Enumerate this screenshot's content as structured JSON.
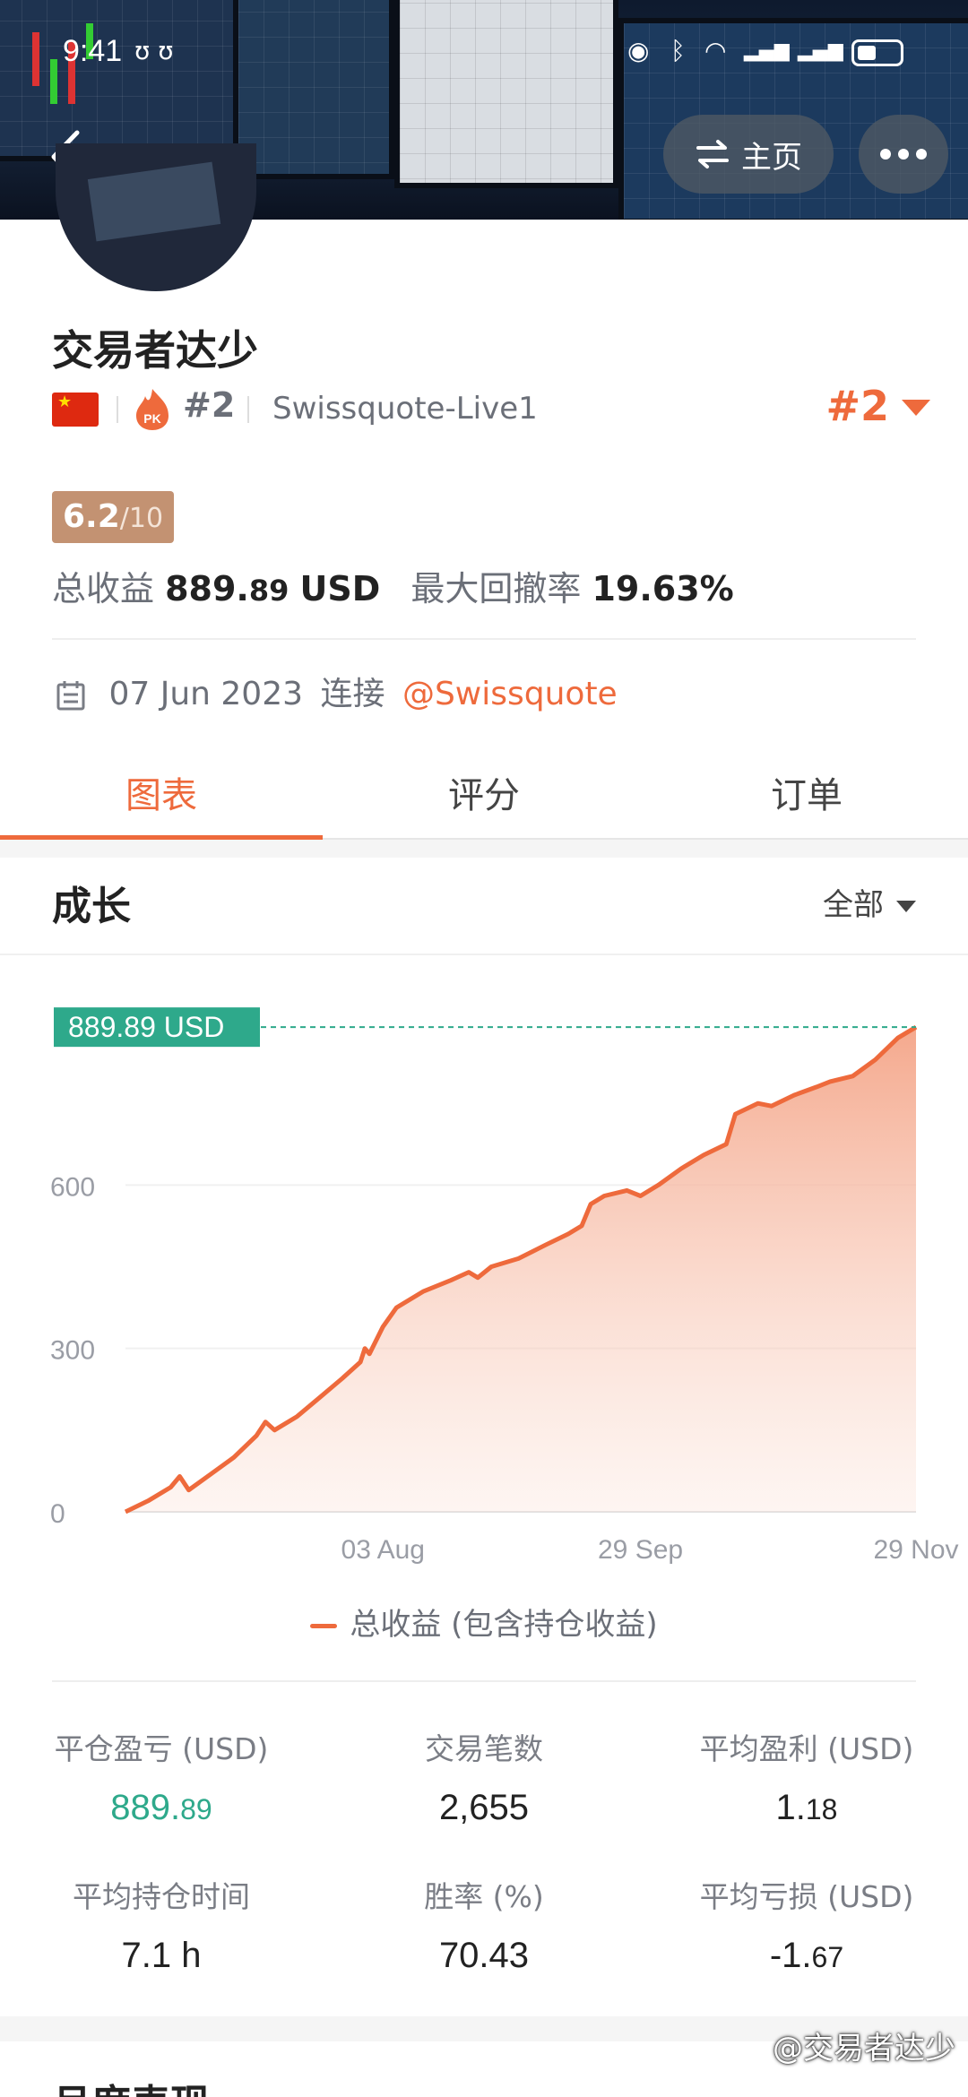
{
  "status_bar": {
    "time": "9:41"
  },
  "header": {
    "home_label": "主页"
  },
  "profile": {
    "name": "交易者达少",
    "rank_small": "#2",
    "server": "Swissquote-Live1",
    "rank_big": "#2",
    "score": "6.2",
    "score_denominator": "/10",
    "total_profit_label": "总收益",
    "total_profit_int": "889.",
    "total_profit_dec": "89",
    "total_profit_unit": "USD",
    "max_drawdown_label": "最大回撤率",
    "max_drawdown_value": "19.63%",
    "connect_date": "07 Jun 2023",
    "connect_label": "连接",
    "broker_link": "@Swissquote"
  },
  "tabs": [
    {
      "label": "图表",
      "active": true
    },
    {
      "label": "评分",
      "active": false
    },
    {
      "label": "订单",
      "active": false
    }
  ],
  "section": {
    "title": "成长",
    "filter": "全部"
  },
  "chart_data": {
    "type": "area",
    "title": "",
    "xlabel": "",
    "ylabel": "",
    "y_ticks": [
      0,
      300,
      600
    ],
    "x_ticks": [
      {
        "label": "03 Aug",
        "date": "2023-08-03"
      },
      {
        "label": "29 Sep",
        "date": "2023-09-29"
      },
      {
        "label": "29 Nov",
        "date": "2023-11-29"
      }
    ],
    "ylim": [
      0,
      900
    ],
    "xlim": [
      "2023-06-07",
      "2023-11-29"
    ],
    "current_label": "889.89 USD",
    "current_value": 889.89,
    "series": [
      {
        "name": "总收益 (包含持仓收益)",
        "points": [
          [
            "2023-06-07",
            0
          ],
          [
            "2023-06-12",
            20
          ],
          [
            "2023-06-17",
            45
          ],
          [
            "2023-06-19",
            65
          ],
          [
            "2023-06-21",
            40
          ],
          [
            "2023-06-26",
            70
          ],
          [
            "2023-07-01",
            100
          ],
          [
            "2023-07-06",
            140
          ],
          [
            "2023-07-08",
            165
          ],
          [
            "2023-07-10",
            150
          ],
          [
            "2023-07-15",
            175
          ],
          [
            "2023-07-20",
            210
          ],
          [
            "2023-07-25",
            245
          ],
          [
            "2023-07-29",
            275
          ],
          [
            "2023-07-30",
            300
          ],
          [
            "2023-07-31",
            290
          ],
          [
            "2023-08-03",
            340
          ],
          [
            "2023-08-06",
            375
          ],
          [
            "2023-08-12",
            405
          ],
          [
            "2023-08-18",
            425
          ],
          [
            "2023-08-22",
            440
          ],
          [
            "2023-08-24",
            430
          ],
          [
            "2023-08-27",
            450
          ],
          [
            "2023-09-02",
            465
          ],
          [
            "2023-09-08",
            490
          ],
          [
            "2023-09-13",
            510
          ],
          [
            "2023-09-16",
            525
          ],
          [
            "2023-09-18",
            565
          ],
          [
            "2023-09-21",
            580
          ],
          [
            "2023-09-26",
            590
          ],
          [
            "2023-09-29",
            580
          ],
          [
            "2023-10-03",
            600
          ],
          [
            "2023-10-08",
            630
          ],
          [
            "2023-10-13",
            655
          ],
          [
            "2023-10-18",
            675
          ],
          [
            "2023-10-20",
            730
          ],
          [
            "2023-10-25",
            750
          ],
          [
            "2023-10-28",
            745
          ],
          [
            "2023-11-02",
            765
          ],
          [
            "2023-11-07",
            780
          ],
          [
            "2023-11-10",
            790
          ],
          [
            "2023-11-15",
            800
          ],
          [
            "2023-11-20",
            830
          ],
          [
            "2023-11-25",
            870
          ],
          [
            "2023-11-29",
            889.89
          ]
        ]
      }
    ],
    "colors": {
      "line": "#ee6a3c",
      "label_bg": "#2ea98b"
    }
  },
  "stats": [
    {
      "label": "平仓盈亏 (USD)",
      "int": "889.",
      "dec": "89",
      "green": true
    },
    {
      "label": "交易笔数",
      "int": "2,655",
      "dec": "",
      "green": false
    },
    {
      "label": "平均盈利 (USD)",
      "int": "1.",
      "dec": "18",
      "green": false
    },
    {
      "label": "平均持仓时间",
      "int": "7.1 h",
      "dec": "",
      "green": false
    },
    {
      "label": "胜率 (%)",
      "int": "70.43",
      "dec": "",
      "green": false
    },
    {
      "label": "平均亏损 (USD)",
      "int": "-1.",
      "dec": "67",
      "green": false
    }
  ],
  "next_section": {
    "title": "月度表现"
  },
  "watermark": "@交易者达少"
}
